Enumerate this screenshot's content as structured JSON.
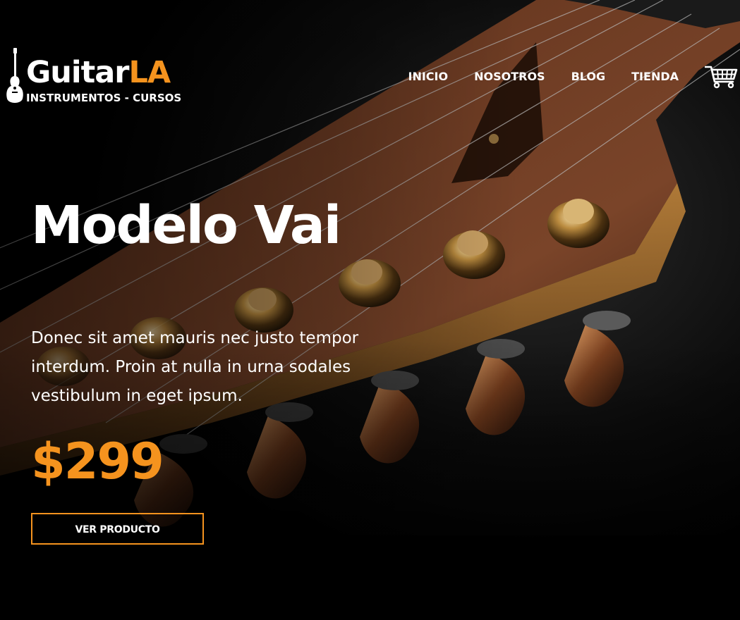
{
  "logo": {
    "name_main": "Guitar",
    "name_accent": "LA",
    "tagline": "INSTRUMENTOS - CURSOS",
    "icon": "guitar-icon"
  },
  "nav": {
    "items": [
      {
        "label": "INICIO"
      },
      {
        "label": "NOSOTROS"
      },
      {
        "label": "BLOG"
      },
      {
        "label": "TIENDA"
      }
    ],
    "cart_icon": "shopping-cart-icon"
  },
  "hero": {
    "title": "Modelo Vai",
    "description": "Donec sit amet mauris nec justo tempor interdum. Proin at nulla in urna sodales vestibulum in eget ipsum.",
    "price": "$299",
    "button_label": "VER PRODUCTO"
  },
  "colors": {
    "accent": "#f5931e",
    "background": "#000000",
    "text": "#ffffff"
  }
}
